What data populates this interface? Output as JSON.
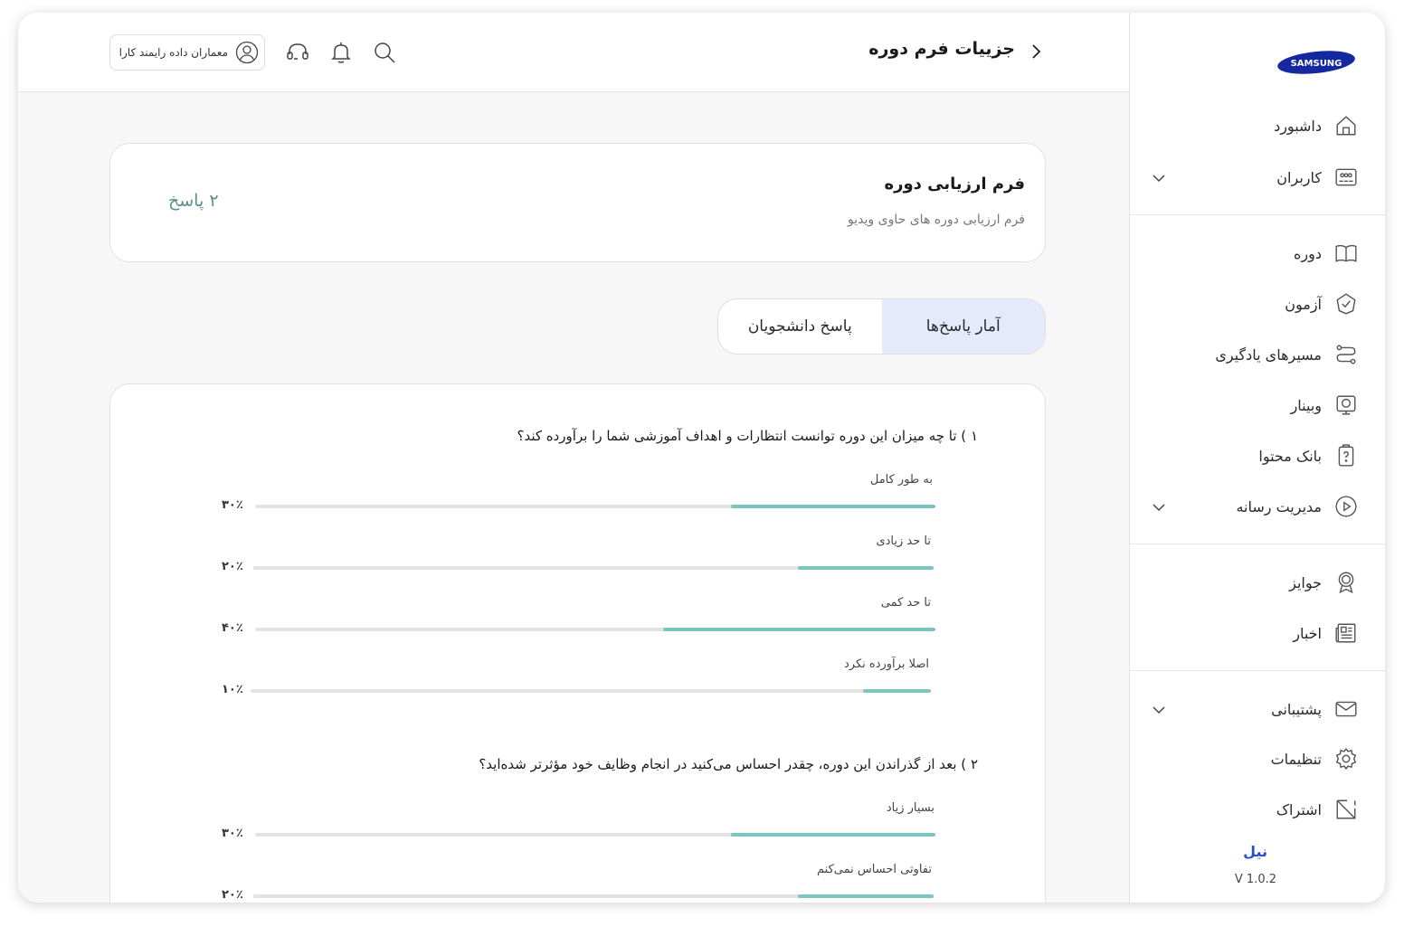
{
  "header": {
    "page_title": "جزییات فرم دوره",
    "user_name": "معماران داده رایمند کارا"
  },
  "sidebar": {
    "logo_text": "SAMSUNG",
    "items": [
      {
        "label": "داشبورد",
        "icon": "home-icon"
      },
      {
        "label": "کاربران",
        "icon": "users-icon",
        "expandable": true
      },
      {
        "label": "دوره",
        "icon": "book-icon"
      },
      {
        "label": "آزمون",
        "icon": "exam-check-icon"
      },
      {
        "label": "مسیرهای یادگیری",
        "icon": "route-icon"
      },
      {
        "label": "وبینار",
        "icon": "webinar-icon"
      },
      {
        "label": "بانک محتوا",
        "icon": "content-bank-icon"
      },
      {
        "label": "مدیریت رسانه",
        "icon": "play-icon",
        "expandable": true
      },
      {
        "label": "جوایز",
        "icon": "award-icon"
      },
      {
        "label": "اخبار",
        "icon": "news-icon"
      },
      {
        "label": "پشتیبانی",
        "icon": "mail-icon",
        "expandable": true
      },
      {
        "label": "تنظیمات",
        "icon": "gear-icon"
      },
      {
        "label": "اشتراک",
        "icon": "share-icon"
      }
    ],
    "brand_name": "نیل",
    "version": "V 1.0.2"
  },
  "form": {
    "title": "فرم ارزیابی دوره",
    "description": "فرم ارزیابی دوره های حاوی ویدیو",
    "response_count": "۲ پاسخ"
  },
  "tabs": [
    {
      "label": "آمار پاسخ‌ها",
      "active": true
    },
    {
      "label": "پاسخ دانشجویان",
      "active": false
    }
  ],
  "questions": [
    {
      "text": "۱ ) تا چه میزان این دوره توانست انتظارات و اهداف آموزشی شما را برآورده کند؟",
      "options": [
        {
          "label": "به طور کامل",
          "percent": 30,
          "percent_label": "۳۰٪"
        },
        {
          "label": "تا حد زیادی",
          "percent": 20,
          "percent_label": "۲۰٪"
        },
        {
          "label": "تا حد کمی",
          "percent": 40,
          "percent_label": "۴۰٪"
        },
        {
          "label": "اصلا برآورده نکرد",
          "percent": 10,
          "percent_label": "۱۰٪"
        }
      ]
    },
    {
      "text": "۲ ) بعد از گذراندن این دوره، چقدر احساس می‌کنید در انجام وظایف خود مؤثرتر شده‌اید؟",
      "options": [
        {
          "label": "بسیار زیاد",
          "percent": 30,
          "percent_label": "۳۰٪"
        },
        {
          "label": "تفاوتی احساس نمی‌کنم",
          "percent": 20,
          "percent_label": "۲۰٪"
        }
      ]
    }
  ],
  "colors": {
    "accent_bar": "#7cc6c1",
    "active_tab": "#e4eafc",
    "brand_blue": "#2a4fc9",
    "response_count": "#5c8f89"
  }
}
